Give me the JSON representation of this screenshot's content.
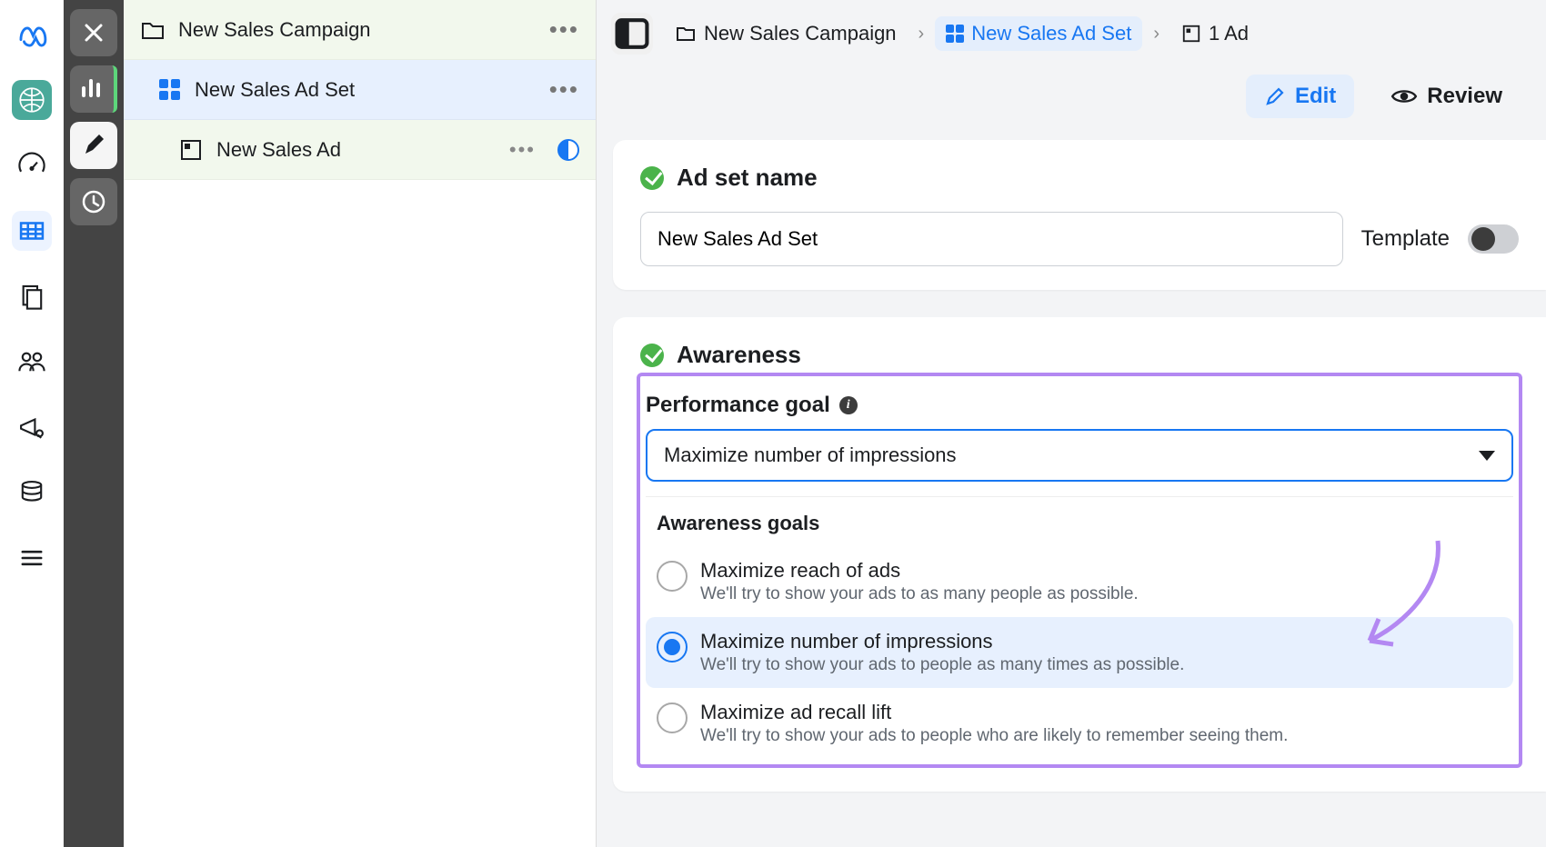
{
  "breadcrumbs": {
    "campaign": "New Sales Campaign",
    "adset": "New Sales Ad Set",
    "ad_count": "1 Ad"
  },
  "actions": {
    "edit": "Edit",
    "review": "Review"
  },
  "hierarchy": {
    "campaign": "New Sales Campaign",
    "adset": "New Sales Ad Set",
    "ad": "New Sales Ad"
  },
  "adset_name": {
    "heading": "Ad set name",
    "value": "New Sales Ad Set",
    "template_label": "Template"
  },
  "awareness": {
    "heading": "Awareness",
    "perf_goal_label": "Performance goal",
    "selected": "Maximize number of impressions",
    "group_label": "Awareness goals",
    "options": [
      {
        "title": "Maximize reach of ads",
        "desc": "We'll try to show your ads to as many people as possible."
      },
      {
        "title": "Maximize number of impressions",
        "desc": "We'll try to show your ads to people as many times as possible."
      },
      {
        "title": "Maximize ad recall lift",
        "desc": "We'll try to show your ads to people who are likely to remember seeing them."
      }
    ]
  },
  "colors": {
    "accent": "#1877f2",
    "highlight": "#b388f2",
    "ok": "#4bb34b"
  }
}
